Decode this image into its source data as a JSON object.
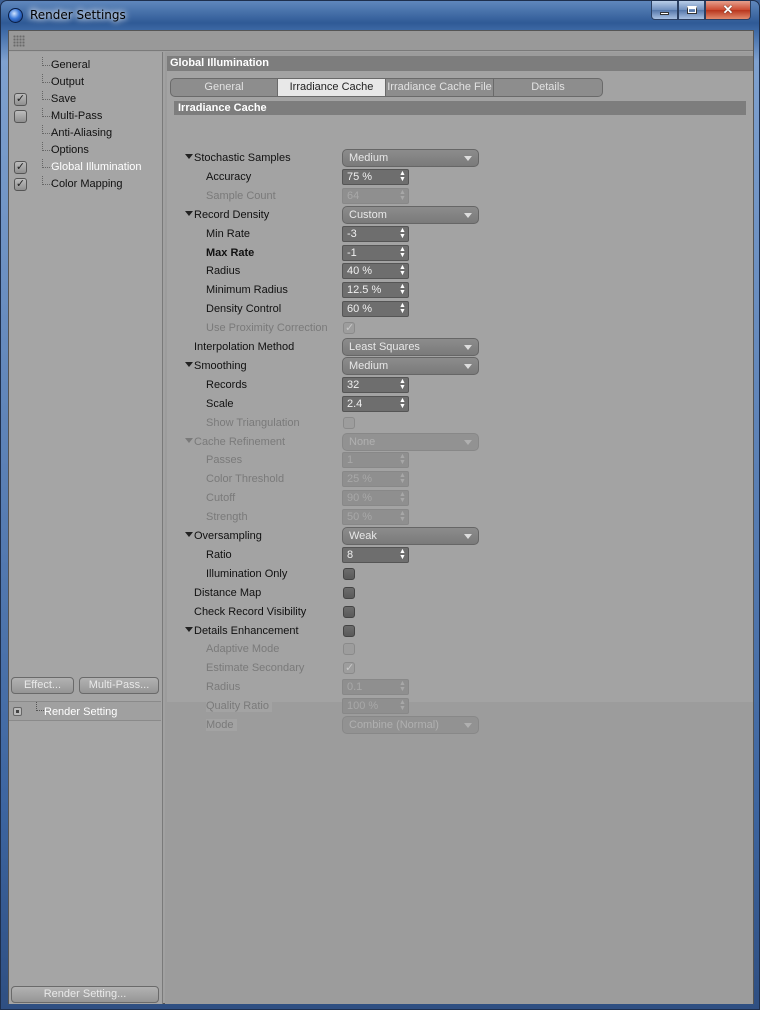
{
  "window": {
    "title": "Render Settings",
    "controls": {
      "minimize": "minimize",
      "maximize": "maximize",
      "close": "close"
    }
  },
  "sidebar": {
    "items": [
      {
        "label": "General",
        "checkbox": false,
        "checked": false,
        "selected": false
      },
      {
        "label": "Output",
        "checkbox": false,
        "checked": false,
        "selected": false
      },
      {
        "label": "Save",
        "checkbox": true,
        "checked": true,
        "selected": false
      },
      {
        "label": "Multi-Pass",
        "checkbox": true,
        "checked": false,
        "selected": false
      },
      {
        "label": "Anti-Aliasing",
        "checkbox": false,
        "checked": false,
        "selected": false
      },
      {
        "label": "Options",
        "checkbox": false,
        "checked": false,
        "selected": false
      },
      {
        "label": "Global Illumination",
        "checkbox": true,
        "checked": true,
        "selected": true
      },
      {
        "label": "Color Mapping",
        "checkbox": true,
        "checked": true,
        "selected": false
      }
    ],
    "effect_button": "Effect...",
    "multipass_button": "Multi-Pass...",
    "render_setting_item": "Render Setting",
    "render_setting_button": "Render Setting..."
  },
  "main": {
    "section_title": "Global Illumination",
    "tabs": [
      {
        "label": "General",
        "active": false
      },
      {
        "label": "Irradiance Cache",
        "active": true
      },
      {
        "label": "Irradiance Cache File",
        "active": false
      },
      {
        "label": "Details",
        "active": false
      }
    ],
    "group_title": "Irradiance Cache",
    "rows": [
      {
        "label": "Stochastic Samples",
        "indent": 0,
        "expand": true,
        "type": "dropdown",
        "value": "Medium",
        "disabled": false
      },
      {
        "label": "Accuracy",
        "indent": 1,
        "type": "number",
        "value": "75 %",
        "disabled": false
      },
      {
        "label": "Sample Count",
        "indent": 1,
        "type": "number",
        "value": "64",
        "disabled": true
      },
      {
        "label": "Record Density",
        "indent": 0,
        "expand": true,
        "type": "dropdown",
        "value": "Custom",
        "disabled": false
      },
      {
        "label": "Min Rate",
        "indent": 1,
        "type": "number",
        "value": "-3",
        "disabled": false
      },
      {
        "label": "Max Rate",
        "indent": 1,
        "type": "number",
        "value": "-1",
        "disabled": false,
        "bold": true
      },
      {
        "label": "Radius",
        "indent": 1,
        "type": "number",
        "value": "40 %",
        "disabled": false
      },
      {
        "label": "Minimum Radius",
        "indent": 1,
        "type": "number",
        "value": "12.5 %",
        "disabled": false
      },
      {
        "label": "Density Control",
        "indent": 1,
        "type": "number",
        "value": "60 %",
        "disabled": false
      },
      {
        "label": "Use Proximity Correction",
        "indent": 1,
        "type": "checkbox",
        "checked": true,
        "disabled": true
      },
      {
        "label": "Interpolation Method",
        "indent": 0,
        "type": "dropdown",
        "value": "Least Squares",
        "disabled": false
      },
      {
        "label": "Smoothing",
        "indent": 0,
        "expand": true,
        "type": "dropdown",
        "value": "Medium",
        "disabled": false
      },
      {
        "label": "Records",
        "indent": 1,
        "type": "number",
        "value": "32",
        "disabled": false
      },
      {
        "label": "Scale",
        "indent": 1,
        "type": "number",
        "value": "2.4",
        "disabled": false
      },
      {
        "label": "Show Triangulation",
        "indent": 1,
        "type": "checkbox",
        "checked": false,
        "disabled": true
      },
      {
        "label": "Cache Refinement",
        "indent": 0,
        "expand": true,
        "type": "dropdown",
        "value": "None",
        "disabled": true
      },
      {
        "label": "Passes",
        "indent": 1,
        "type": "number",
        "value": "1",
        "disabled": true
      },
      {
        "label": "Color Threshold",
        "indent": 1,
        "type": "number",
        "value": "25 %",
        "disabled": true
      },
      {
        "label": "Cutoff",
        "indent": 1,
        "type": "number",
        "value": "90 %",
        "disabled": true
      },
      {
        "label": "Strength",
        "indent": 1,
        "type": "number",
        "value": "50 %",
        "disabled": true
      },
      {
        "label": "Oversampling",
        "indent": 0,
        "expand": true,
        "type": "dropdown",
        "value": "Weak",
        "disabled": false
      },
      {
        "label": "Ratio",
        "indent": 1,
        "type": "number",
        "value": "8",
        "disabled": false
      },
      {
        "label": "Illumination Only",
        "indent": 1,
        "type": "checkbox",
        "checked": false,
        "disabled": false
      },
      {
        "label": "Distance Map",
        "indent": 0,
        "type": "checkbox",
        "checked": false,
        "disabled": false
      },
      {
        "label": "Check Record Visibility",
        "indent": 0,
        "type": "checkbox",
        "checked": false,
        "disabled": false
      },
      {
        "label": "Details Enhancement",
        "indent": 0,
        "expand": true,
        "type": "checkbox",
        "checked": false,
        "disabled": false
      },
      {
        "label": "Adaptive Mode",
        "indent": 1,
        "type": "checkbox",
        "checked": false,
        "disabled": true
      },
      {
        "label": "Estimate Secondary",
        "indent": 1,
        "type": "checkbox",
        "checked": true,
        "disabled": true
      },
      {
        "label": "Radius",
        "indent": 1,
        "type": "number",
        "value": "0.1",
        "disabled": true
      },
      {
        "label": "Quality Ratio",
        "indent": 1,
        "type": "number",
        "value": "100 %",
        "disabled": true
      },
      {
        "label": "Mode",
        "indent": 1,
        "type": "dropdown",
        "value": "Combine (Normal)",
        "disabled": true
      }
    ]
  }
}
